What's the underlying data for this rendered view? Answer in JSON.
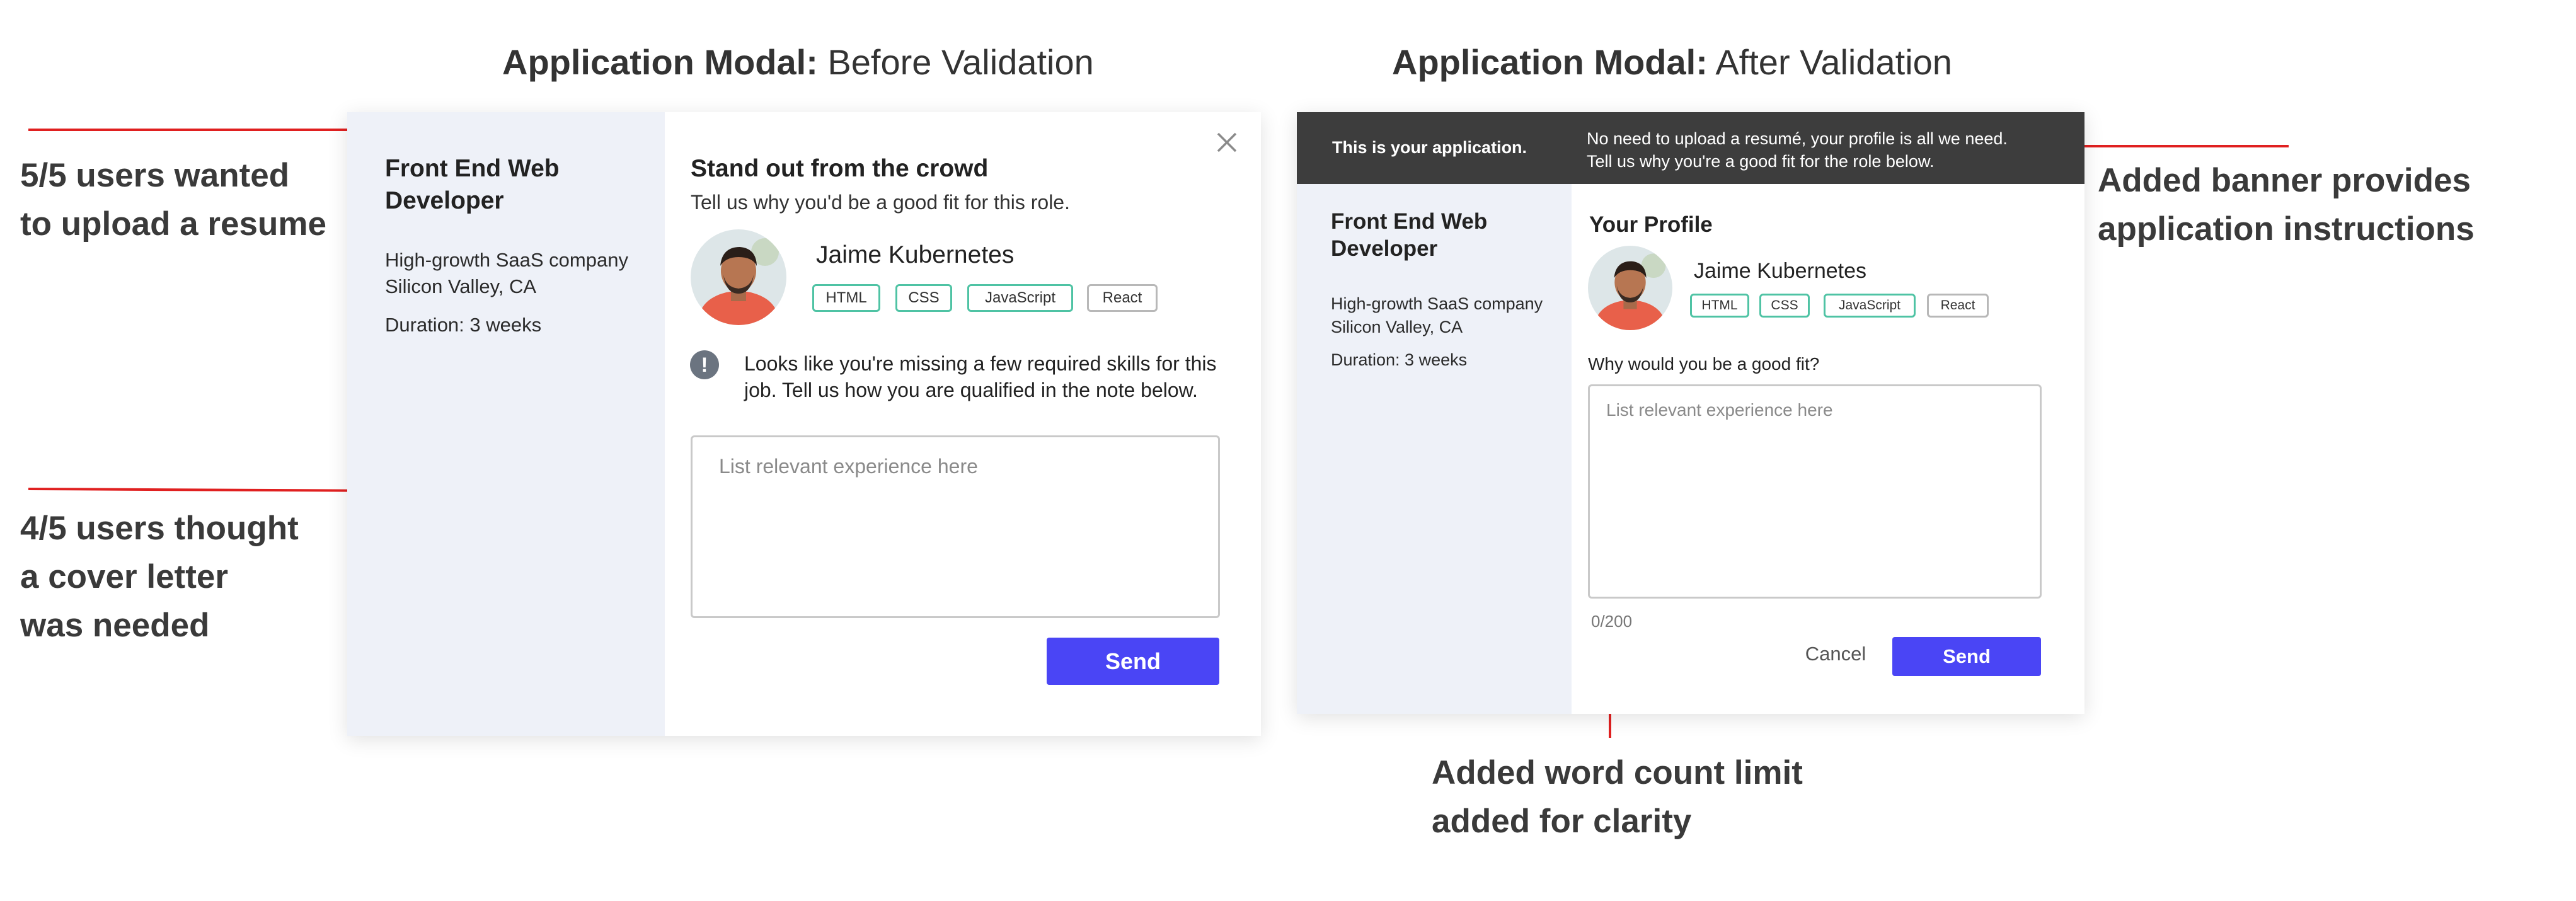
{
  "left_header": {
    "bold": "Application Modal:",
    "rest": " Before Validation"
  },
  "right_header": {
    "bold": "Application Modal:",
    "rest": " After Validation"
  },
  "annotations": {
    "resume": [
      "5/5 users wanted",
      "to upload a resume"
    ],
    "cover": [
      "4/5 users thought",
      "a cover letter",
      "was needed"
    ],
    "banner": [
      "Added banner provides",
      "application instructions"
    ],
    "wordcount": [
      "Added word count limit",
      "added for clarity"
    ]
  },
  "before": {
    "job": {
      "title_line1": "Front End Web",
      "title_line2": "Developer",
      "company": "High-growth SaaS company",
      "location": "Silicon Valley, CA",
      "duration": "Duration: 3 weeks"
    },
    "heading": "Stand out from the crowd",
    "subheading": "Tell us why you'd be a good fit for this role.",
    "candidate": "Jaime Kubernetes",
    "skills": [
      "HTML",
      "CSS",
      "JavaScript",
      "React"
    ],
    "warning_line1": "Looks like you're missing a few required skills for this",
    "warning_line2": "job. Tell us how you are qualified in the note below.",
    "textarea_placeholder": "List relevant experience here",
    "send_label": "Send"
  },
  "after": {
    "banner_left": "This is your application.",
    "banner_line1": "No need to upload a resumé, your profile is all we need.",
    "banner_line2": "Tell us why you're a good fit for the role below.",
    "job": {
      "title_line1": "Front End Web",
      "title_line2": "Developer",
      "company": "High-growth SaaS company",
      "location": "Silicon Valley, CA",
      "duration": "Duration: 3 weeks"
    },
    "profile_heading": "Your Profile",
    "candidate": "Jaime Kubernetes",
    "skills": [
      "HTML",
      "CSS",
      "JavaScript",
      "React"
    ],
    "question": "Why would you be a good fit?",
    "textarea_placeholder": "List relevant experience here",
    "counter": "0/200",
    "cancel_label": "Cancel",
    "send_label": "Send"
  },
  "colors": {
    "accent": "#4a45f5",
    "annotation_line": "#e02020",
    "skill_border": "#4fc3a4",
    "banner": "#3d3d3d",
    "sidebar": "#eef1f8"
  },
  "icons": {
    "close": "close-icon",
    "warning": "exclamation-icon"
  }
}
